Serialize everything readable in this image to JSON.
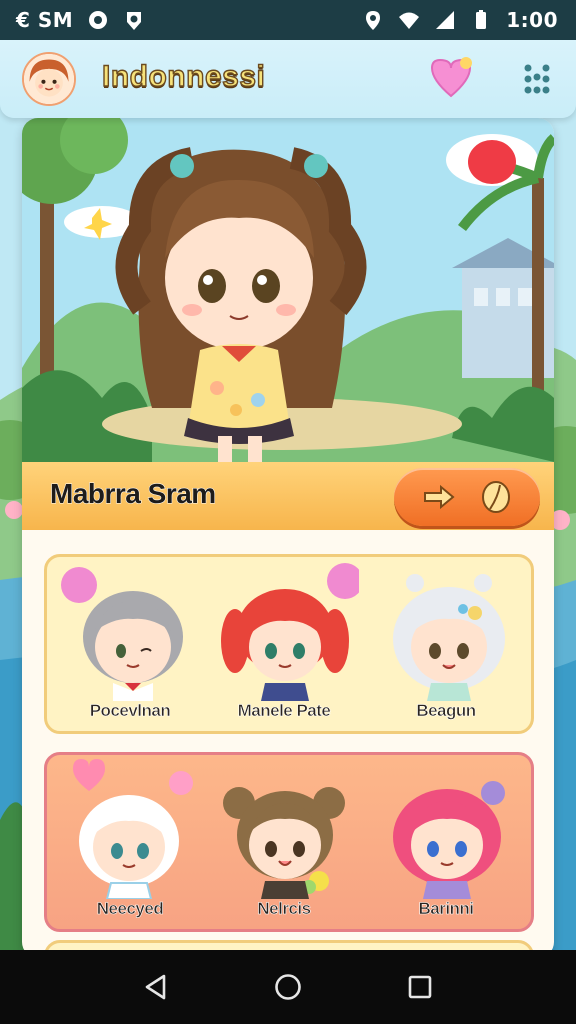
{
  "status_bar": {
    "left_text": "€ SM",
    "time": "1:00"
  },
  "header": {
    "title": "Indonnessi",
    "menu_icon": "grid-dots-icon",
    "favorite_icon": "heart-bubble-icon"
  },
  "featured": {
    "name": "Mabrra Sram",
    "action_icons": [
      "arrow-right-icon",
      "leaf-icon"
    ]
  },
  "character_rows": [
    {
      "cells": [
        {
          "name": "Pocevlnan",
          "hair": "#a9a9ad",
          "accent": "#f08ad0"
        },
        {
          "name": "Manele Pate",
          "hair": "#e8443a",
          "accent": "#3f4d8f"
        },
        {
          "name": "Beagun",
          "hair": "#e9ecf1",
          "accent": "#f5d56a"
        }
      ]
    },
    {
      "cells": [
        {
          "name": "Neecyed",
          "hair": "#ffffff",
          "accent": "#ff8bb0"
        },
        {
          "name": "Nelrcis",
          "hair": "#8c6d45",
          "accent": "#9fd86c"
        },
        {
          "name": "Barinni",
          "hair": "#ef4f7e",
          "accent": "#a48cd9"
        }
      ]
    }
  ],
  "nav": {
    "back": "back-triangle-icon",
    "home": "home-circle-icon",
    "recents": "recents-square-icon"
  },
  "colors": {
    "status_bar": "#1d3d45",
    "header_bg": "#c9edf8",
    "name_bar": "#f7b54c",
    "action_pill": "#f06f25",
    "row1_bg": "#fff3c4",
    "row2_bg": "#f7a383"
  }
}
